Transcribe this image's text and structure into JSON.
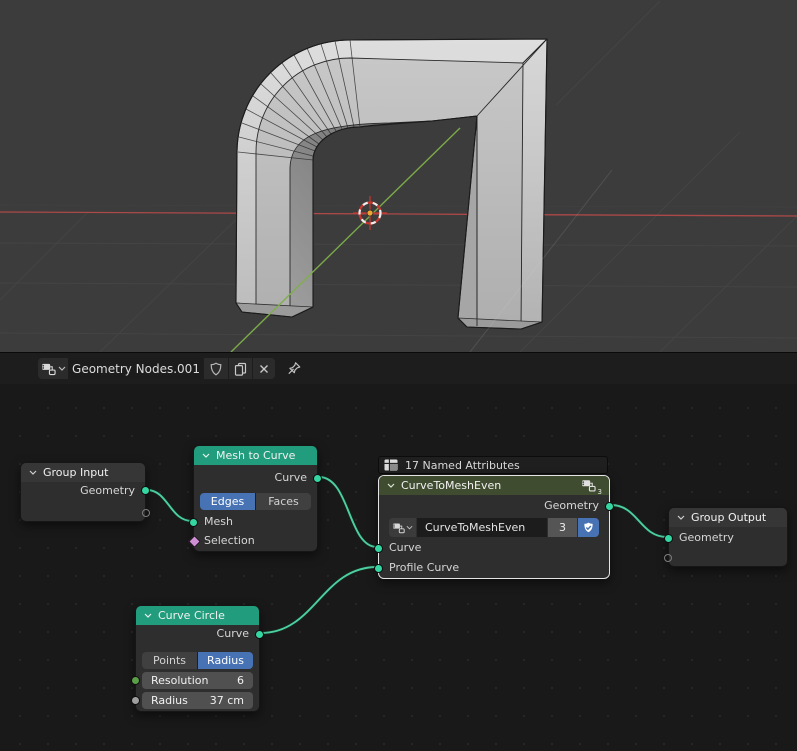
{
  "editor_bar": {
    "datablock_name": "Geometry Nodes.001"
  },
  "canvas": {
    "named_attributes_badge": "17 Named Attributes"
  },
  "nodes": {
    "group_input": {
      "title": "Group Input",
      "outputs": {
        "geometry": "Geometry"
      }
    },
    "mesh_to_curve": {
      "title": "Mesh to Curve",
      "outputs": {
        "curve": "Curve"
      },
      "mode": {
        "edges": "Edges",
        "faces": "Faces",
        "selected": "Edges"
      },
      "inputs": {
        "mesh": "Mesh",
        "selection": "Selection"
      }
    },
    "curve_to_mesh_even": {
      "title": "CurveToMeshEven",
      "outputs": {
        "geometry": "Geometry"
      },
      "group_name": "CurveToMeshEven",
      "user_count": "3",
      "inputs": {
        "curve": "Curve",
        "profile_curve": "Profile Curve"
      }
    },
    "group_output": {
      "title": "Group Output",
      "inputs": {
        "geometry": "Geometry"
      }
    },
    "curve_circle": {
      "title": "Curve Circle",
      "outputs": {
        "curve": "Curve"
      },
      "mode": {
        "points": "Points",
        "radius": "Radius",
        "selected": "Radius"
      },
      "fields": {
        "resolution_label": "Resolution",
        "resolution_value": "6",
        "radius_label": "Radius",
        "radius_value": "37 cm"
      }
    }
  },
  "colors": {
    "accent_blue": "#4772b3",
    "node_header_geometry": "#219c7c",
    "node_header_group": "#3f4c2f",
    "wire": "#4ecfa1",
    "socket_geometry": "#34d6a2",
    "socket_integer": "#5a9e47",
    "socket_float": "#9f9f9f",
    "socket_boolean": "#cf8fd4",
    "axis_x": "#b84a4a",
    "axis_y": "#7faf4a"
  }
}
